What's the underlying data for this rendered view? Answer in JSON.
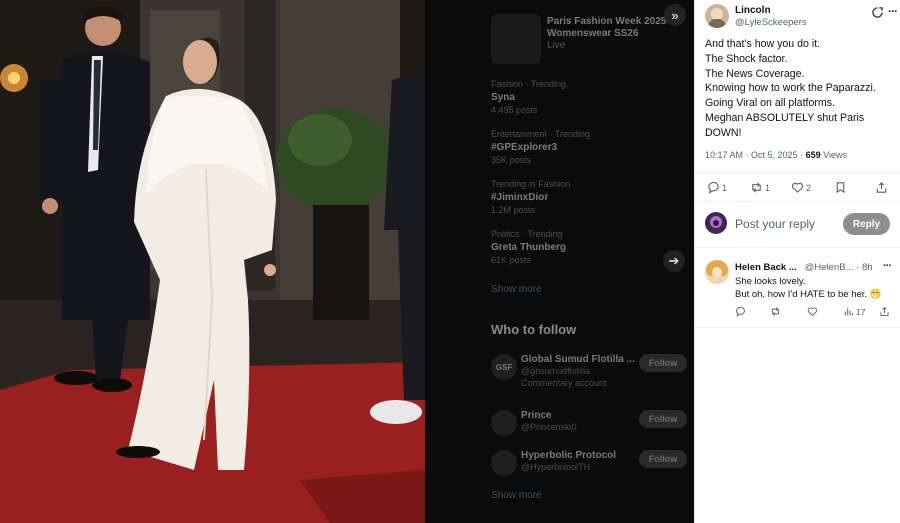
{
  "colors": {
    "carpet": "#9a1f1f",
    "reply_button_bg": "#8e8e8e",
    "secondary_text": "#536471",
    "backdrop": "#0b0b0b"
  },
  "background": {
    "top_trend": {
      "title": "Paris Fashion Week 2025",
      "subtitle": "Womenswear SS26",
      "extra": "Live"
    },
    "trends": [
      {
        "meta": "Fashion · Trending",
        "name": "Syna",
        "count": "4,495 posts"
      },
      {
        "meta": "Entertainment · Trending",
        "name": "#GPExplorer3",
        "count": "35K posts"
      },
      {
        "meta": "Trending in Fashion",
        "name": "#JiminxDior",
        "count": "1.2M posts"
      },
      {
        "meta": "Politics · Trending",
        "name": "Greta Thunberg",
        "count": "61K posts"
      }
    ],
    "show_more": "Show more",
    "who_to_follow_title": "Who to follow",
    "suggestions": [
      {
        "avatar": "GSF",
        "name": "Global Sumud Flotilla ...",
        "handle": "@gbsumudflotilla",
        "extra": "Commentary account",
        "button": "Follow"
      },
      {
        "avatar": "",
        "name": "Prince",
        "handle": "@Princenski0",
        "extra": "",
        "button": "Follow"
      },
      {
        "avatar": "",
        "name": "Hyperbolic Protocol",
        "handle": "@HyperboloolTH",
        "extra": "",
        "button": "Follow"
      }
    ],
    "show_more_2": "Show more",
    "next_icon": "arrow-right-icon",
    "collapse_icon": "double-chevron-right-icon"
  },
  "post": {
    "author_name": "Lincoln",
    "author_handle": "@LyleSckeepers",
    "grok_icon": "grok-icon",
    "more_icon": "more-dots-icon",
    "lines": [
      "And that's how you do it.",
      "The Shock factor.",
      "The News Coverage.",
      "Knowing how to work the Paparazzi.",
      "Going Viral on all platforms.",
      "Meghan ABSOLUTELY shut Paris DOWN!"
    ],
    "timestamp": "10:17 AM · Oct 5, 2025 · ",
    "views_count": "659",
    "views_label": " Views",
    "actions": {
      "reply_count": "1",
      "repost_count": "1",
      "like_count": "2"
    }
  },
  "compose": {
    "placeholder": "Post your reply",
    "button_label": "Reply"
  },
  "reply": {
    "name": "Helen Back ...",
    "handle": "@HelenB...",
    "time": " · 8h",
    "line1": "She looks lovely.",
    "line2": "But oh, how I'd HATE to be her. 😁",
    "views_count": "17"
  }
}
